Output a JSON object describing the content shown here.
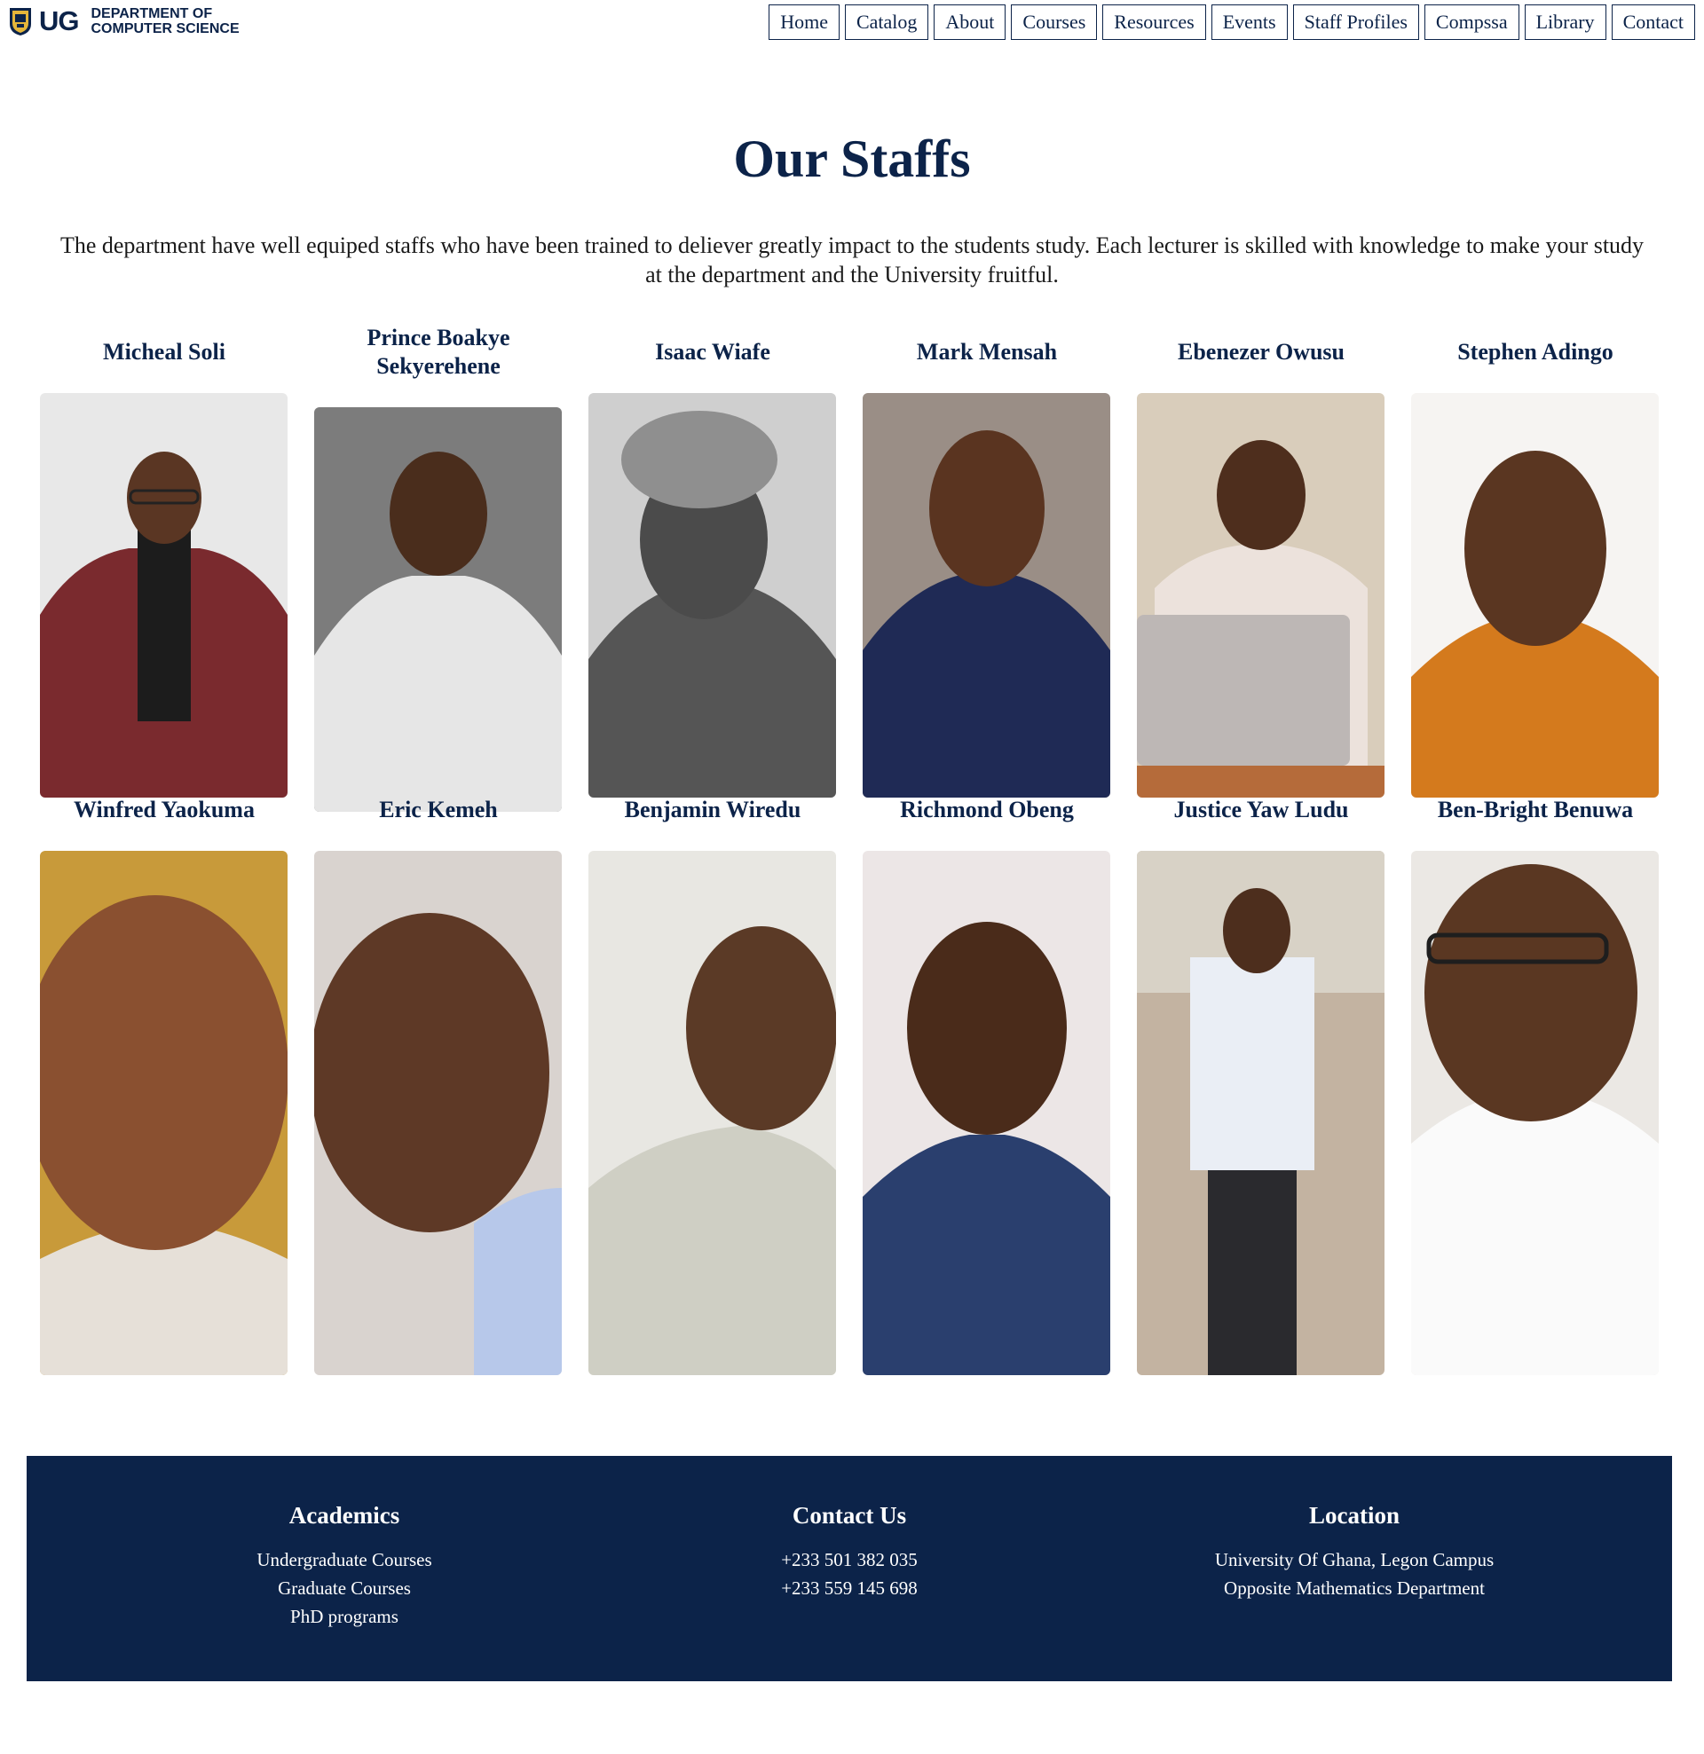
{
  "header": {
    "logo_text": "UG",
    "dept_line1": "DEPARTMENT OF",
    "dept_line2": "COMPUTER SCIENCE",
    "nav": [
      "Home",
      "Catalog",
      "About",
      "Courses",
      "Resources",
      "Events",
      "Staff Profiles",
      "Compssa",
      "Library",
      "Contact"
    ]
  },
  "main": {
    "title": "Our Staffs",
    "intro": "The department have well equiped staffs who have been trained to deliever greatly impact to the students study. Each lecturer is skilled with knowledge to make your study at the department and the University fruitful.",
    "staff": [
      {
        "name": "Micheal Soli"
      },
      {
        "name": "Prince Boakye Sekyerehene"
      },
      {
        "name": "Isaac Wiafe"
      },
      {
        "name": "Mark Mensah"
      },
      {
        "name": "Ebenezer Owusu"
      },
      {
        "name": "Stephen Adingo"
      },
      {
        "name": "Winfred Yaokuma"
      },
      {
        "name": "Eric Kemeh"
      },
      {
        "name": "Benjamin Wiredu"
      },
      {
        "name": "Richmond Obeng"
      },
      {
        "name": "Justice Yaw Ludu"
      },
      {
        "name": "Ben-Bright Benuwa"
      }
    ]
  },
  "footer": {
    "academics": {
      "heading": "Academics",
      "links": [
        "Undergraduate Courses",
        "Graduate Courses",
        "PhD programs"
      ]
    },
    "contact": {
      "heading": "Contact Us",
      "phones": [
        "+233 501 382 035",
        "+233 559 145 698"
      ]
    },
    "location": {
      "heading": "Location",
      "lines": [
        "University Of Ghana, Legon Campus",
        "Opposite Mathematics Department"
      ]
    }
  },
  "colors": {
    "brand": "#0c2349",
    "background": "#ffffff",
    "footer_text": "#ffffff"
  },
  "icons": {
    "crest": "university-crest-icon"
  }
}
